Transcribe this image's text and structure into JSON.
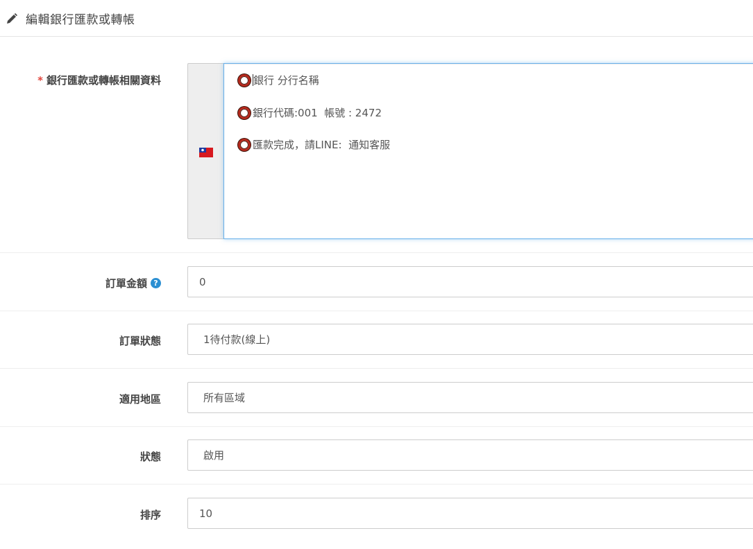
{
  "header": {
    "title": "編輯銀行匯款或轉帳"
  },
  "form": {
    "bank_info": {
      "label": "銀行匯款或轉帳相關資料",
      "required_mark": "*",
      "lines": [
        "銀行 分行名稱",
        "銀行代碼:001  帳號 : 2472",
        "匯款完成，請LINE:  通知客服"
      ]
    },
    "order_amount": {
      "label": "訂單金額",
      "help": "?",
      "value": "0"
    },
    "order_status": {
      "label": "訂單狀態",
      "value": "1待付款(線上)"
    },
    "region": {
      "label": "適用地區",
      "value": "所有區域"
    },
    "status": {
      "label": "狀態",
      "value": "啟用"
    },
    "sort_order": {
      "label": "排序",
      "value": "10"
    }
  },
  "icons": {
    "header": "pencil-icon",
    "flag": "taiwan-flag-icon",
    "bullet": "ring-icon",
    "help": "question-circle-icon"
  },
  "colors": {
    "required": "#e2453c",
    "help_icon": "#2b8fd2",
    "focus_border": "#66afe9",
    "bullet_ring": "#b52a1e"
  }
}
